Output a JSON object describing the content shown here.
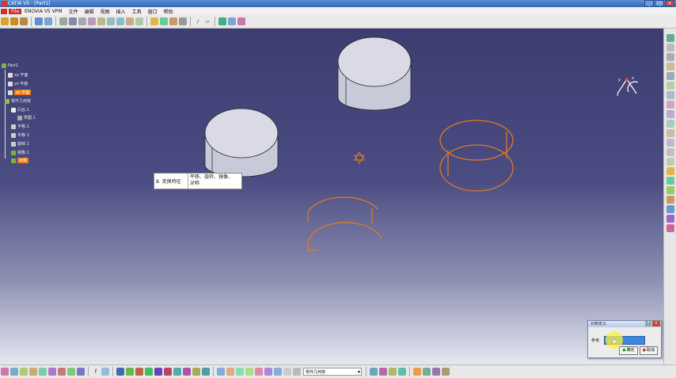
{
  "window": {
    "title": "CATIA V5 - [Part1]",
    "min": "_",
    "max": "□",
    "close": "×"
  },
  "menu": [
    "File",
    "ENOVIA V5 VPM",
    "文件",
    "编辑",
    "视图",
    "插入",
    "工具",
    "窗口",
    "帮助"
  ],
  "tree": {
    "root": "Part1",
    "items": [
      {
        "label": "xy 平面",
        "selected": false
      },
      {
        "label": "yz 平面",
        "selected": false
      },
      {
        "label": "zx 平面",
        "selected": true
      },
      {
        "label": "零件几何体",
        "selected": false
      },
      {
        "label": "凸台.1",
        "selected": false
      },
      {
        "label": "草图.1",
        "selected": false
      },
      {
        "label": "平移.1",
        "selected": false
      },
      {
        "label": "平移.1",
        "selected": false
      },
      {
        "label": "旋转.1",
        "selected": false
      },
      {
        "label": "镜像.1",
        "selected": false
      },
      {
        "label": "对称",
        "selected": true
      }
    ]
  },
  "tooltip": {
    "label": "8. 变换特征",
    "desc_line1": "平移、旋转、镜像、",
    "desc_line2": "对称"
  },
  "dialog": {
    "title": "对称定义",
    "field_label": "参考:",
    "ok": "确定",
    "cancel": "取消",
    "help": "?",
    "close": "×"
  },
  "bottombar": {
    "body_select": "零件几何体"
  },
  "colors": {
    "viewport_top": "#3c3e71",
    "wire": "#e07a22",
    "selection": "#f07c18"
  }
}
